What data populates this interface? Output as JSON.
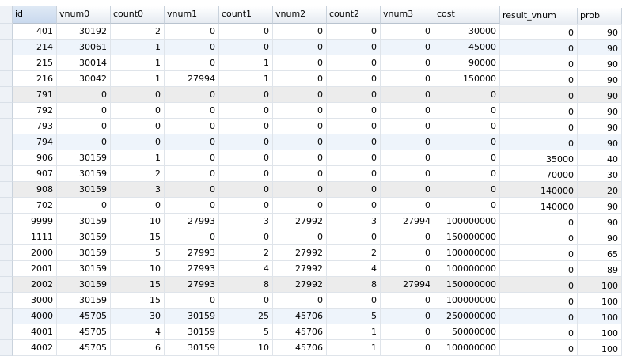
{
  "columns": [
    "id",
    "vnum0",
    "count0",
    "vnum1",
    "count1",
    "vnum2",
    "count2",
    "vnum3",
    "cost",
    "result_vnum",
    "prob"
  ],
  "rows": [
    [
      "401",
      "30192",
      "2",
      "0",
      "0",
      "0",
      "0",
      "0",
      "30000",
      "0",
      "90"
    ],
    [
      "214",
      "30061",
      "1",
      "0",
      "0",
      "0",
      "0",
      "0",
      "45000",
      "0",
      "90"
    ],
    [
      "215",
      "30014",
      "1",
      "0",
      "1",
      "0",
      "0",
      "0",
      "90000",
      "0",
      "90"
    ],
    [
      "216",
      "30042",
      "1",
      "27994",
      "1",
      "0",
      "0",
      "0",
      "150000",
      "0",
      "90"
    ],
    [
      "791",
      "0",
      "0",
      "0",
      "0",
      "0",
      "0",
      "0",
      "0",
      "0",
      "90"
    ],
    [
      "792",
      "0",
      "0",
      "0",
      "0",
      "0",
      "0",
      "0",
      "0",
      "0",
      "90"
    ],
    [
      "793",
      "0",
      "0",
      "0",
      "0",
      "0",
      "0",
      "0",
      "0",
      "0",
      "90"
    ],
    [
      "794",
      "0",
      "0",
      "0",
      "0",
      "0",
      "0",
      "0",
      "0",
      "0",
      "90"
    ],
    [
      "906",
      "30159",
      "1",
      "0",
      "0",
      "0",
      "0",
      "0",
      "0",
      "35000",
      "40"
    ],
    [
      "907",
      "30159",
      "2",
      "0",
      "0",
      "0",
      "0",
      "0",
      "0",
      "70000",
      "30"
    ],
    [
      "908",
      "30159",
      "3",
      "0",
      "0",
      "0",
      "0",
      "0",
      "0",
      "140000",
      "20"
    ],
    [
      "702",
      "0",
      "0",
      "0",
      "0",
      "0",
      "0",
      "0",
      "0",
      "140000",
      "90"
    ],
    [
      "9999",
      "30159",
      "10",
      "27993",
      "3",
      "27992",
      "3",
      "27994",
      "100000000",
      "0",
      "90"
    ],
    [
      "1111",
      "30159",
      "15",
      "0",
      "0",
      "0",
      "0",
      "0",
      "150000000",
      "0",
      "90"
    ],
    [
      "2000",
      "30159",
      "5",
      "27993",
      "2",
      "27992",
      "2",
      "0",
      "100000000",
      "0",
      "65"
    ],
    [
      "2001",
      "30159",
      "10",
      "27993",
      "4",
      "27992",
      "4",
      "0",
      "100000000",
      "0",
      "89"
    ],
    [
      "2002",
      "30159",
      "15",
      "27993",
      "8",
      "27992",
      "8",
      "27994",
      "150000000",
      "0",
      "100"
    ],
    [
      "3000",
      "30159",
      "15",
      "0",
      "0",
      "0",
      "0",
      "0",
      "100000000",
      "0",
      "100"
    ],
    [
      "4000",
      "45705",
      "30",
      "30159",
      "25",
      "45706",
      "5",
      "0",
      "250000000",
      "0",
      "100"
    ],
    [
      "4001",
      "45705",
      "4",
      "30159",
      "5",
      "45706",
      "1",
      "0",
      "50000000",
      "0",
      "100"
    ],
    [
      "4002",
      "45705",
      "6",
      "30159",
      "10",
      "45706",
      "1",
      "0",
      "100000000",
      "0",
      "100"
    ]
  ]
}
